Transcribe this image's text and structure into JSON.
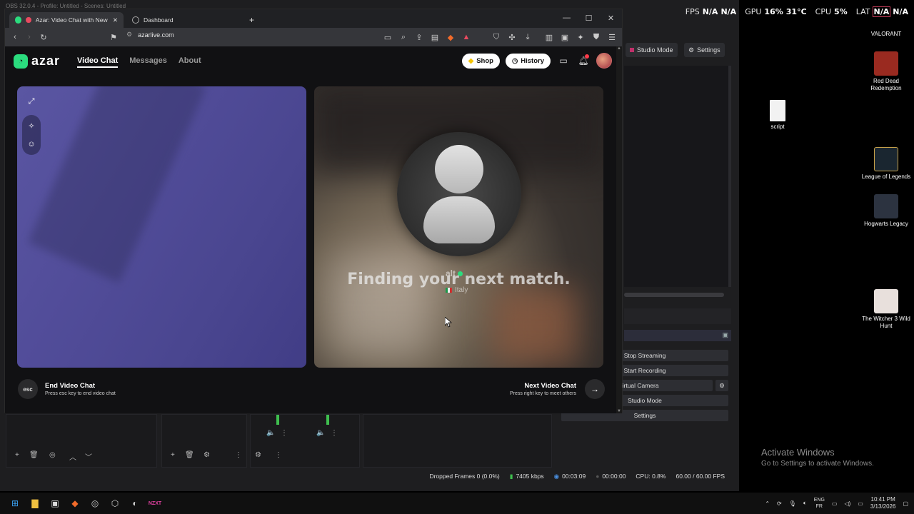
{
  "hud": {
    "fps_label": "FPS",
    "fps_v1": "N/A",
    "fps_v2": "N/A",
    "gpu_label": "GPU",
    "gpu_value": "16%",
    "gpu_temp": "31°C",
    "cpu_label": "CPU",
    "cpu_value": "5%",
    "lat_label": "LAT",
    "lat_v1": "N/A",
    "lat_v2": "N/A"
  },
  "desktop_icons": [
    {
      "label": "VALORANT",
      "color": "#2a2a2a"
    },
    {
      "label": "Red Dead Redemption",
      "color": "#b22a1e"
    },
    {
      "label": "script",
      "color": "#f2f2f2"
    },
    {
      "label": "League of Legends",
      "color": "#c8a24a"
    },
    {
      "label": "Hogwarts Legacy",
      "color": "#2c3340"
    },
    {
      "label": "The Witcher 3 Wild Hunt",
      "color": "#c02028"
    }
  ],
  "watermark": {
    "line1": "Activate Windows",
    "line2": "Go to Settings to activate Windows."
  },
  "obs": {
    "title": "OBS 32.0.4 - Profile: Untitled - Scenes: Untitled",
    "studio_mode_top": "Studio Mode",
    "settings_top": "Settings",
    "controls": [
      "Stop Streaming",
      "Start Recording",
      "t Virtual Camera",
      "Studio Mode",
      "Settings"
    ],
    "status": {
      "dropped": "Dropped Frames 0 (0.0%)",
      "bitrate": "7405 kbps",
      "stream_time": "00:03:09",
      "rec_time": "00:00:00",
      "cpu": "CPU: 0.8%",
      "fps": "60.00 / 60.00 FPS"
    }
  },
  "browser": {
    "tabs": [
      {
        "title": "Azar: Video Chat with New Pe",
        "active": true
      },
      {
        "title": "Dashboard",
        "active": false
      }
    ],
    "new_tab": "+",
    "url": "azarlive.com"
  },
  "azar": {
    "logo_text": "azar",
    "nav": [
      {
        "label": "Video Chat",
        "active": true
      },
      {
        "label": "Messages",
        "active": false
      },
      {
        "label": "About",
        "active": false
      }
    ],
    "shop_label": "Shop",
    "history_label": "History",
    "notification_count": "1",
    "match": {
      "status": "Finding your next match.",
      "name": "alt",
      "country": "Italy"
    },
    "end_chat": {
      "key": "esc",
      "title": "End Video Chat",
      "subtitle": "Press esc key to end video chat"
    },
    "next_chat": {
      "key": "→",
      "title": "Next Video Chat",
      "subtitle": "Press right key to meet others"
    }
  },
  "taskbar": {
    "lang_top": "ENG",
    "lang_bottom": "FR",
    "time": "10:41 PM",
    "date": "3/13/2026"
  },
  "colors": {
    "azar_green": "#2bdc7e",
    "azar_purple_panel": "#524d9a",
    "notification_red": "#ff3b4a"
  }
}
